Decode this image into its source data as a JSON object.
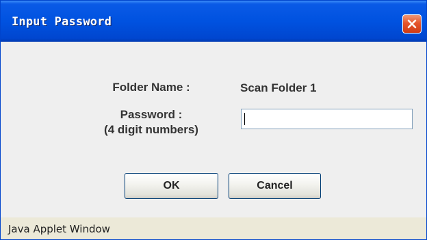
{
  "window": {
    "title": "Input Password",
    "close_icon": "close-x-icon",
    "accent_color": "#0052e0",
    "close_color": "#e5562c"
  },
  "form": {
    "folder_label": "Folder Name :",
    "folder_value": "Scan Folder 1",
    "password_label": "Password :",
    "password_hint": "(4 digit numbers)",
    "password_value": ""
  },
  "buttons": {
    "ok_label": "OK",
    "cancel_label": "Cancel"
  },
  "status": {
    "text": "Java Applet Window"
  }
}
